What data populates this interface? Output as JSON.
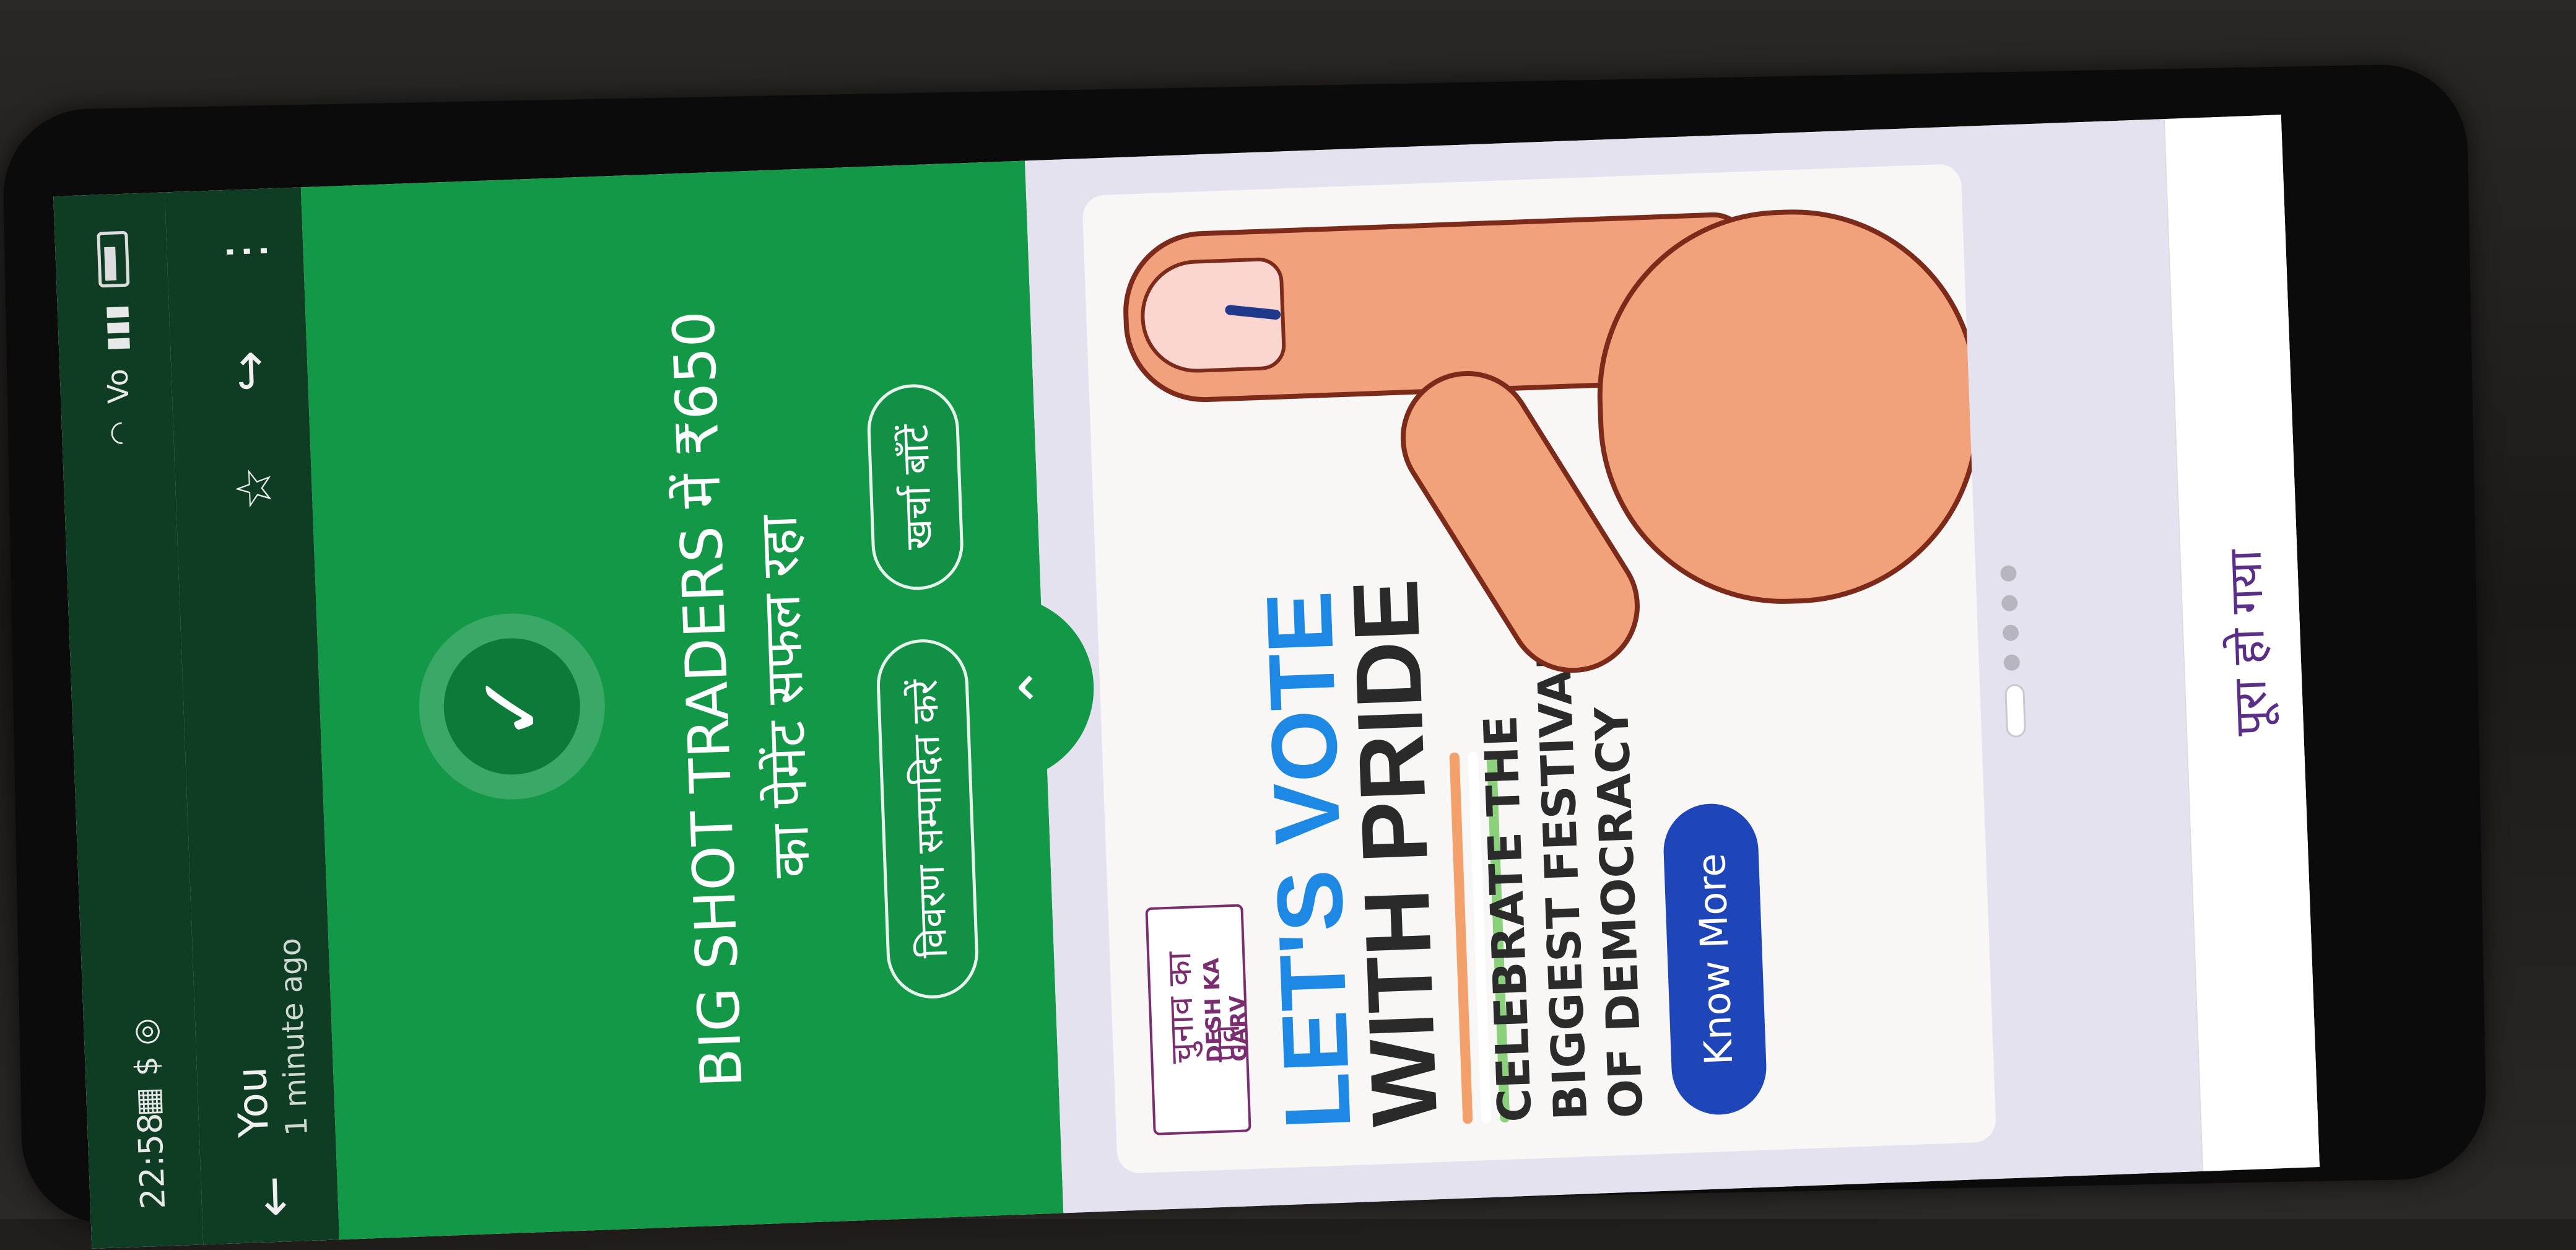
{
  "status": {
    "time": "22:58",
    "icons": [
      "image-icon",
      "paytm-icon",
      "instagram-icon"
    ],
    "right": [
      "wifi-icon",
      "volte-icon",
      "signal-icon",
      "battery-icon"
    ]
  },
  "header": {
    "back_label": "←",
    "sender": "You",
    "time_ago": "1 minute ago",
    "actions": [
      "star-icon",
      "forward-icon",
      "more-icon"
    ]
  },
  "payment": {
    "check": "✓",
    "line1": "BIG SHOT TRADERS में ₹650",
    "line2": "का पेमेंट सफल रहा",
    "btn_details": "विवरण सम्पादित करें",
    "btn_split": "खर्चा बाँटें"
  },
  "ad": {
    "badge_hindi": "चुनाव का पर्व",
    "badge_eng": "DESH KA GARV",
    "headline1": "LET'S VOTE",
    "headline2": "WITH PRIDE",
    "sub": "CELEBRATE THE BIGGEST FESTIVAL OF DEMOCRACY",
    "cta": "Know More"
  },
  "footer": {
    "done": "पूरा हो गया"
  },
  "colors": {
    "green": "#139847",
    "dark_green": "#0f3d24",
    "ad_blue": "#1e88e5",
    "button_blue": "#1f46b8"
  }
}
